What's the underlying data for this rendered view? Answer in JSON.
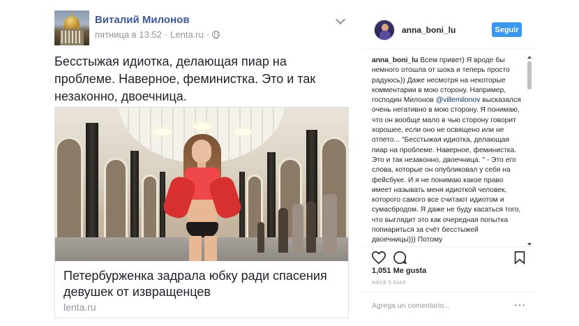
{
  "facebook_post": {
    "author": "Виталий Милонов",
    "timestamp": "пятница в 13:52",
    "separator": "·",
    "source": "Lenta.ru",
    "separator2": "·",
    "text": "Бесстыжая идиотка, делающая пиар на проблеме. Наверное, феминистка. Это и так незаконно, двоечница.",
    "link_card": {
      "title": "Петербурженка задрала юбку ради спасения девушек от извращенцев",
      "domain": "lenta.ru"
    }
  },
  "instagram_post": {
    "username": "anna_boni_lu",
    "follow_label": "Seguir",
    "caption_user": "anna_boni_lu",
    "caption_part1": " Всем привет) Я вроде бы немного отошла от шока и теперь просто радуюсь)) Даже несмотря на некоторые комментарии в мою сторону. Например, господин Милонов ",
    "caption_mention": "@villemilonov",
    "caption_part2": " высказался очень негативно в мою сторону. Я понимаю, что он вообще мало в чью сторону говорит хорошее, если оно не освящено или не отпето... \"Бесстыжая идиотка, делающая пиар на проблеме. Наверное, феминистка. Это и так незаконно, двоечница. \" - Это его слова, которые он опубликовал у себя на фейсбуке. И я не понимаю какое право имеет называть меня идиоткой человек, которого самого все считают идиотом и сумасбродом. Я даже не буду касаться того, что выглядит это как очередная попытка попиариться за счёт бесстыжей двоечницы))) Потому",
    "likes": "1,051 Me gusta",
    "time_ago": "HACE 5 DÍAS",
    "comment_placeholder": "Agrega un comentario...",
    "more": "···"
  },
  "colors": {
    "facebook_link": "#3b5998",
    "meta_gray": "#90949c",
    "instagram_button": "#3897f0",
    "instagram_text": "#262626"
  },
  "icons": [
    "globe-icon",
    "chevron-down-icon",
    "heart-icon",
    "comment-icon",
    "bookmark-icon",
    "more-icon"
  ]
}
